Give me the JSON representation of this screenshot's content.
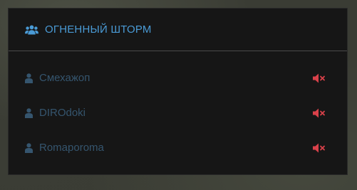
{
  "group": {
    "title": "ОГНЕННЫЙ ШТОРМ",
    "icon": "users-icon",
    "accent_color": "#4a9bd6"
  },
  "members": [
    {
      "name": "Смехажоп",
      "icon": "user-icon",
      "status_icon": "muted-speaker-icon"
    },
    {
      "name": "DIROdoki",
      "icon": "user-icon",
      "status_icon": "muted-speaker-icon"
    },
    {
      "name": "Romaporoma",
      "icon": "user-icon",
      "status_icon": "muted-speaker-icon"
    }
  ],
  "colors": {
    "member_name": "#35556e",
    "muted_icon": "#d9414a",
    "panel_bg": "#161616"
  }
}
